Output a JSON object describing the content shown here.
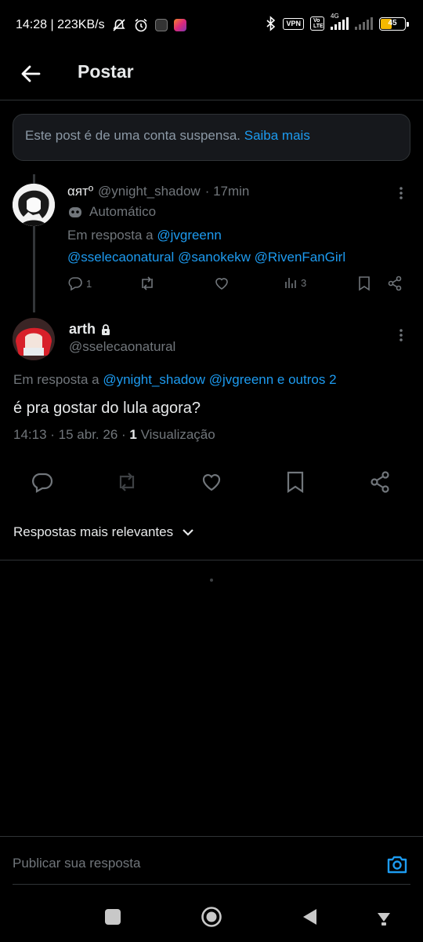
{
  "status_bar": {
    "time_speed": "14:28 | 223KB/s",
    "vpn": "VPN",
    "volte": "Vo LTE",
    "network": "4G",
    "battery": "45"
  },
  "header": {
    "title": "Postar"
  },
  "notice": {
    "text": "Este post é de uma conta suspensa. ",
    "link": "Saiba mais"
  },
  "parent_post": {
    "display_name": "αятº",
    "handle": "@ynight_shadow",
    "time": "· 17min",
    "automated_label": "Automático",
    "reply_prefix": "Em resposta a ",
    "reply_first": "@jvgreenn",
    "reply_mentions": [
      "@sselecaonatural",
      "@sanokekw",
      "@RivenFanGirl"
    ],
    "replies": "1",
    "views": "3"
  },
  "main_post": {
    "display_name": "arth",
    "handle": "@sselecaonatural",
    "reply_prefix": "Em resposta a ",
    "reply_to": "@ynight_shadow @jvgreenn e outros 2",
    "text": "é pra gostar do lula agora?",
    "timestamp": "14:13 · 15 abr. 26 · ",
    "views_count": "1",
    "views_label": " Visualização"
  },
  "sort": {
    "label": "Respostas mais relevantes"
  },
  "reply_box": {
    "placeholder": "Publicar sua resposta"
  },
  "colors": {
    "accent": "#1d9bf0",
    "muted": "#71767b",
    "bg": "#000000",
    "battery": "#f5b800"
  }
}
